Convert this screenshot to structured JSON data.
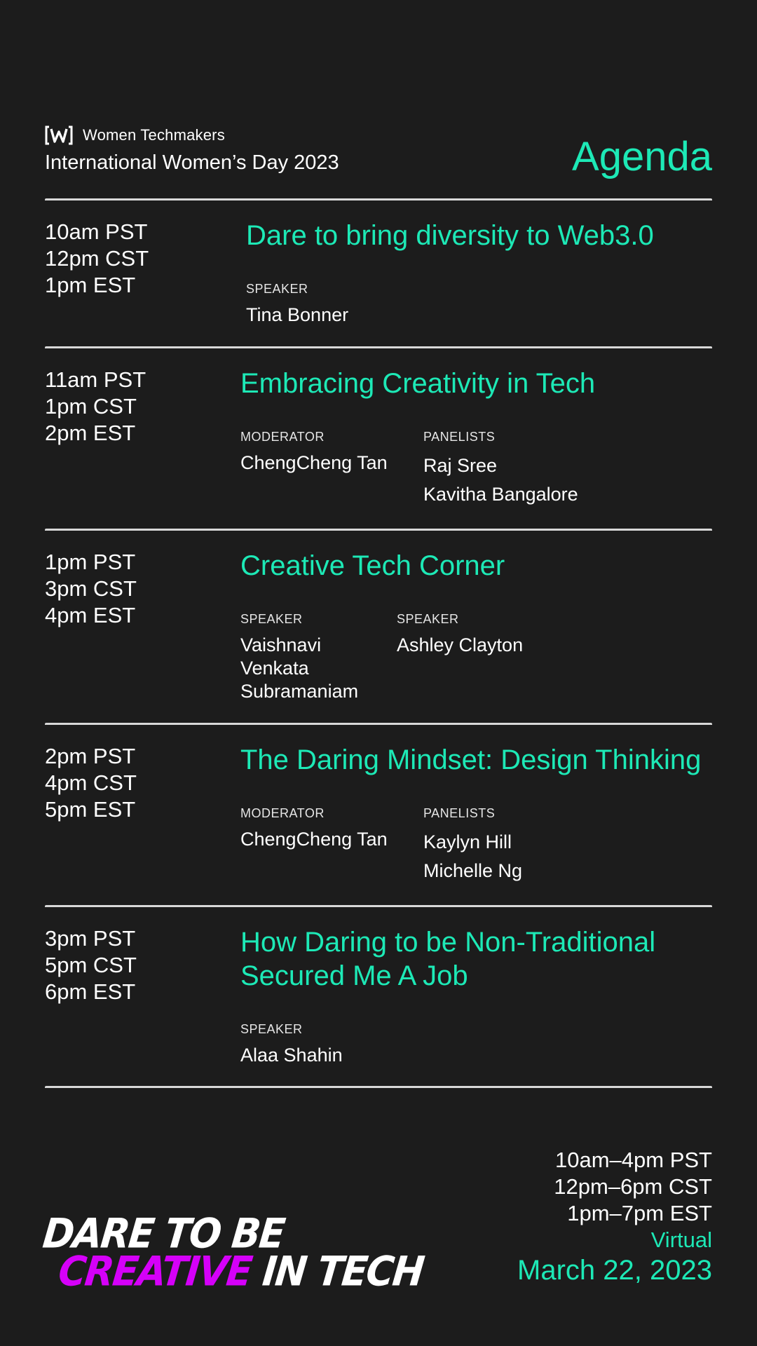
{
  "header": {
    "brand_name": "Women Techmakers",
    "event_name": "International Women’s Day 2023",
    "page_title": "Agenda"
  },
  "sessions": [
    {
      "times": [
        "10am PST",
        "12pm CST",
        "1pm EST"
      ],
      "title": "Dare to bring diversity to Web3.0",
      "roles": [
        {
          "label": "SPEAKER",
          "people": [
            "Tina Bonner"
          ]
        }
      ]
    },
    {
      "times": [
        "11am PST",
        "1pm CST",
        "2pm EST"
      ],
      "title": "Embracing Creativity in Tech",
      "roles": [
        {
          "label": "MODERATOR",
          "people": [
            "ChengCheng Tan"
          ]
        },
        {
          "label": "PANELISTS",
          "people": [
            "Raj Sree",
            "Kavitha Bangalore"
          ]
        }
      ]
    },
    {
      "times": [
        "1pm PST",
        "3pm CST",
        "4pm EST"
      ],
      "title": "Creative Tech Corner",
      "roles": [
        {
          "label": "SPEAKER",
          "people": [
            "Vaishnavi",
            "Venkata",
            "Subramaniam"
          ]
        },
        {
          "label": "SPEAKER",
          "people": [
            "Ashley Clayton"
          ]
        }
      ]
    },
    {
      "times": [
        "2pm PST",
        "4pm CST",
        "5pm EST"
      ],
      "title": "The Daring Mindset: Design Thinking",
      "roles": [
        {
          "label": "MODERATOR",
          "people": [
            "ChengCheng Tan"
          ]
        },
        {
          "label": "PANELISTS",
          "people": [
            "Kaylyn Hill",
            "Michelle Ng"
          ]
        }
      ]
    },
    {
      "times": [
        "3pm PST",
        "5pm CST",
        "6pm EST"
      ],
      "title": "How Daring to be Non-Traditional Secured Me A Job",
      "roles": [
        {
          "label": "SPEAKER",
          "people": [
            "Alaa Shahin"
          ]
        }
      ]
    }
  ],
  "footer": {
    "tagline": {
      "line1": "DARE TO BE",
      "highlight": "CREATIVE",
      "rest": " IN TECH"
    },
    "times": [
      "10am–4pm PST",
      "12pm–6pm CST",
      "1pm–7pm EST"
    ],
    "mode": "Virtual",
    "date": "March 22, 2023"
  },
  "colors": {
    "background": "#1c1c1c",
    "accent_teal": "#1de9b6",
    "accent_magenta": "#d500f9",
    "text": "#ffffff"
  },
  "icons": {
    "brand_logo": "women-techmakers-logo"
  }
}
